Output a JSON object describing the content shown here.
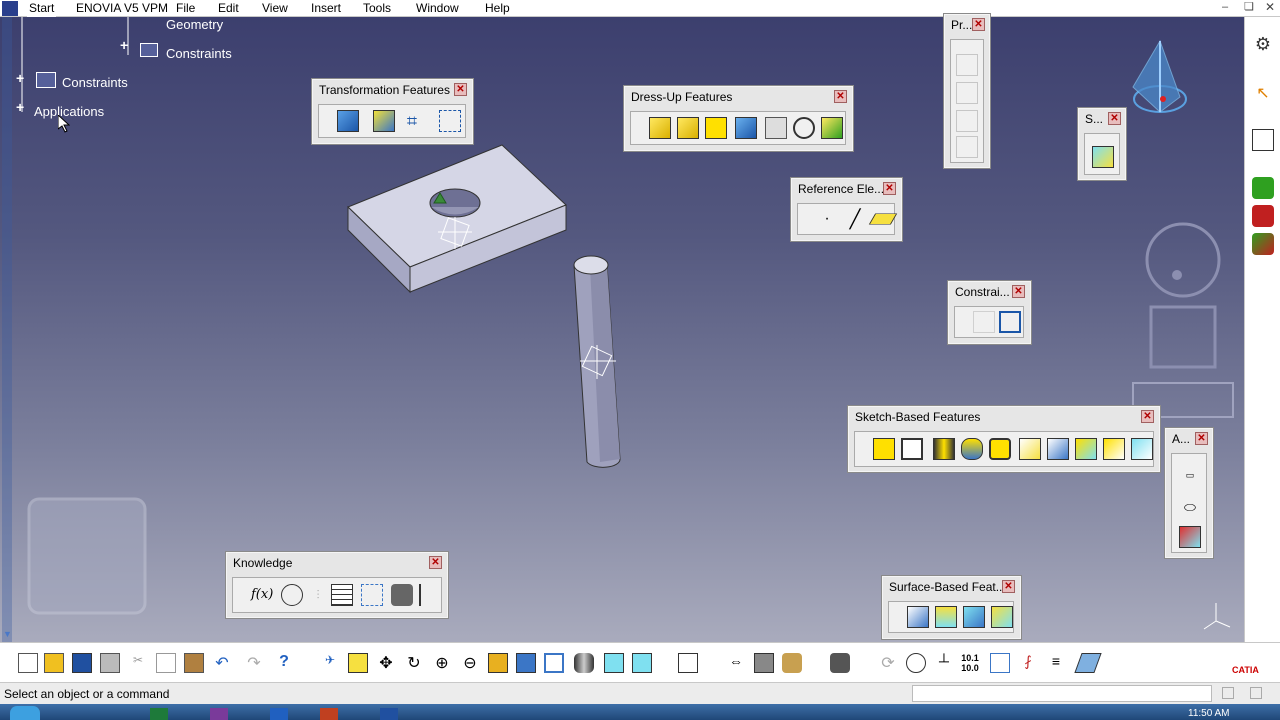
{
  "menubar": {
    "start": "Start",
    "items": [
      "ENOVIA V5 VPM",
      "File",
      "Edit",
      "View",
      "Insert",
      "Tools",
      "Window",
      "Help"
    ]
  },
  "tree": {
    "geometry": "Geometry",
    "constraints_child": "Constraints",
    "constraints": "Constraints",
    "applications": "Applications"
  },
  "toolbars": {
    "transformation": "Transformation Features",
    "dressup": "Dress-Up Features",
    "reference": "Reference Ele...",
    "constraint": "Constrai...",
    "sketch": "Sketch-Based Features",
    "knowledge": "Knowledge",
    "surface": "Surface-Based Feat...",
    "pr": "Pr...",
    "s": "S...",
    "a": "A..."
  },
  "status": {
    "message": "Select an object or a command",
    "command_value": ""
  },
  "taskbar": {
    "time": "11:50 AM"
  },
  "colors": {
    "viewport_top": "#3c3f6e",
    "viewport_bottom": "#a9abbd",
    "close": "#b00000"
  },
  "icons": [
    "close-icon",
    "sketch-icon",
    "pad-icon",
    "pocket-icon",
    "hole-icon",
    "fillet-icon",
    "chamfer-icon",
    "compass-icon",
    "new-icon",
    "open-icon",
    "save-icon",
    "print-icon"
  ]
}
